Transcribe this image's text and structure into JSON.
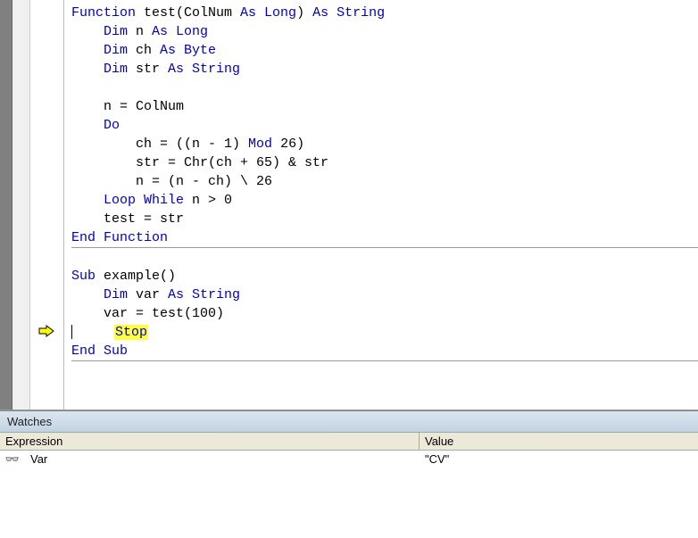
{
  "code": {
    "lines": [
      {
        "indent": 0,
        "tokens": [
          {
            "t": "Function ",
            "c": "kw"
          },
          {
            "t": "test(ColNum ",
            "c": "txt"
          },
          {
            "t": "As Long",
            "c": "kw"
          },
          {
            "t": ") ",
            "c": "txt"
          },
          {
            "t": "As String",
            "c": "kw"
          }
        ]
      },
      {
        "indent": 1,
        "tokens": [
          {
            "t": "Dim ",
            "c": "kw"
          },
          {
            "t": "n ",
            "c": "txt"
          },
          {
            "t": "As Long",
            "c": "kw"
          }
        ]
      },
      {
        "indent": 1,
        "tokens": [
          {
            "t": "Dim ",
            "c": "kw"
          },
          {
            "t": "ch ",
            "c": "txt"
          },
          {
            "t": "As Byte",
            "c": "kw"
          }
        ]
      },
      {
        "indent": 1,
        "tokens": [
          {
            "t": "Dim ",
            "c": "kw"
          },
          {
            "t": "str ",
            "c": "txt"
          },
          {
            "t": "As String",
            "c": "kw"
          }
        ]
      },
      {
        "indent": 0,
        "tokens": []
      },
      {
        "indent": 1,
        "tokens": [
          {
            "t": "n = ColNum",
            "c": "txt"
          }
        ]
      },
      {
        "indent": 1,
        "tokens": [
          {
            "t": "Do",
            "c": "kw"
          }
        ]
      },
      {
        "indent": 2,
        "tokens": [
          {
            "t": "ch = ((n - 1) ",
            "c": "txt"
          },
          {
            "t": "Mod",
            "c": "kw"
          },
          {
            "t": " 26)",
            "c": "txt"
          }
        ]
      },
      {
        "indent": 2,
        "tokens": [
          {
            "t": "str = Chr(ch + 65) & str",
            "c": "txt"
          }
        ]
      },
      {
        "indent": 2,
        "tokens": [
          {
            "t": "n = (n - ch) \\ 26",
            "c": "txt"
          }
        ]
      },
      {
        "indent": 1,
        "tokens": [
          {
            "t": "Loop While ",
            "c": "kw"
          },
          {
            "t": "n > 0",
            "c": "txt"
          }
        ]
      },
      {
        "indent": 1,
        "tokens": [
          {
            "t": "test = str",
            "c": "txt"
          }
        ]
      },
      {
        "indent": 0,
        "tokens": [
          {
            "t": "End Function",
            "c": "kw"
          }
        ],
        "ruleAfter": true
      },
      {
        "indent": 0,
        "tokens": []
      },
      {
        "indent": 0,
        "tokens": [
          {
            "t": "Sub ",
            "c": "kw"
          },
          {
            "t": "example()",
            "c": "txt"
          }
        ]
      },
      {
        "indent": 1,
        "tokens": [
          {
            "t": "Dim ",
            "c": "kw"
          },
          {
            "t": "var ",
            "c": "txt"
          },
          {
            "t": "As String",
            "c": "kw"
          }
        ]
      },
      {
        "indent": 1,
        "tokens": [
          {
            "t": "var = test(100)",
            "c": "txt"
          }
        ]
      },
      {
        "indent": 1,
        "tokens": [
          {
            "t": "Stop",
            "c": "kw"
          }
        ],
        "highlight": true,
        "arrow": true,
        "caret": true
      },
      {
        "indent": 0,
        "tokens": [
          {
            "t": "End Sub",
            "c": "kw"
          }
        ],
        "ruleAfter": true
      }
    ]
  },
  "watches": {
    "title": "Watches",
    "headers": {
      "expression": "Expression",
      "value": "Value"
    },
    "rows": [
      {
        "icon": "👓",
        "expression": "Var",
        "value": "\"CV\""
      }
    ]
  }
}
